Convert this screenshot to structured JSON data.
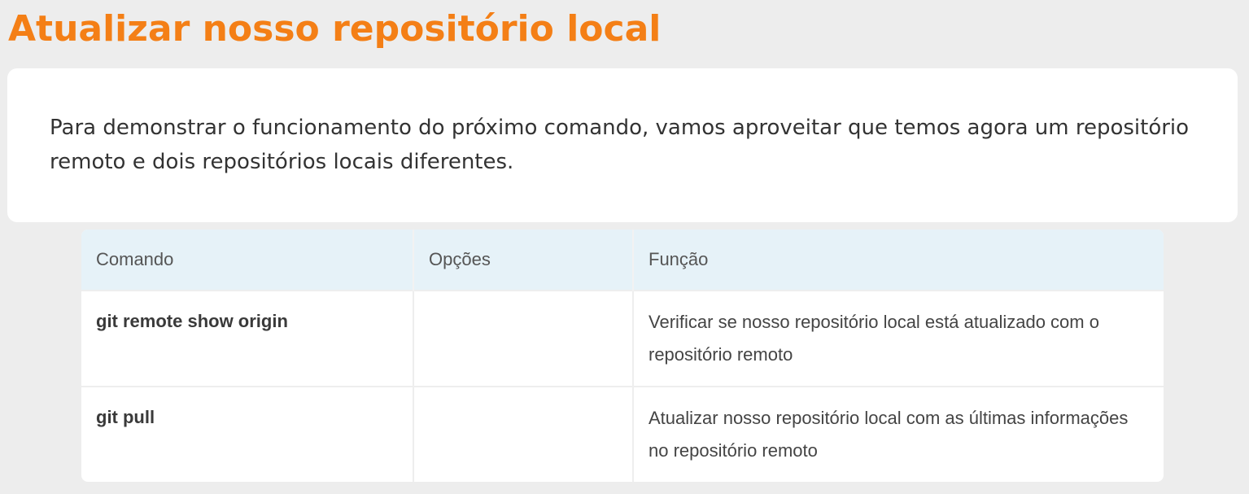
{
  "title": "Atualizar nosso repositório local",
  "intro": "Para demonstrar o funcionamento do próximo comando, vamos aproveitar que temos agora um repositório remoto e dois repositórios locais diferentes.",
  "table": {
    "headers": [
      "Comando",
      "Opções",
      "Função"
    ],
    "rows": [
      {
        "command": "git remote show origin",
        "options": "",
        "function": "Verificar se nosso repositório local está atualizado com o repositório remoto"
      },
      {
        "command": "git pull",
        "options": "",
        "function": "Atualizar nosso repositório local com as últimas informações no repositório remoto"
      }
    ]
  },
  "colors": {
    "title": "#f47f16",
    "background": "#ededed",
    "card": "#ffffff",
    "table_header": "#e6f2f8"
  }
}
